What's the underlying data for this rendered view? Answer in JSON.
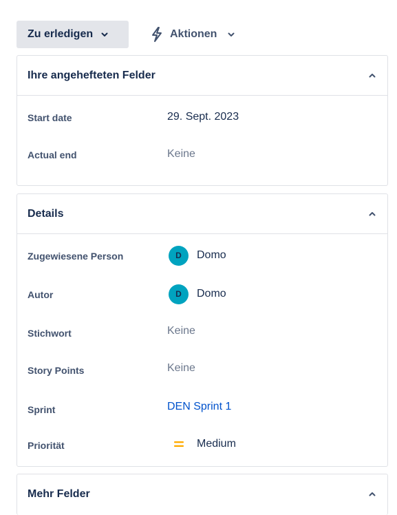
{
  "toolbar": {
    "status_label": "Zu erledigen",
    "actions_label": "Aktionen"
  },
  "pinned": {
    "title": "Ihre angehefteten Felder",
    "fields": [
      {
        "label": "Start date",
        "value": "29. Sept. 2023"
      },
      {
        "label": "Actual end",
        "value": "Keine"
      }
    ]
  },
  "details": {
    "title": "Details",
    "assignee": {
      "label": "Zugewiesene Person",
      "initial": "D",
      "value": "Domo"
    },
    "reporter": {
      "label": "Autor",
      "initial": "D",
      "value": "Domo"
    },
    "labels": {
      "label": "Stichwort",
      "value": "Keine"
    },
    "story_points": {
      "label": "Story Points",
      "value": "Keine"
    },
    "sprint": {
      "label": "Sprint",
      "value": "DEN Sprint 1"
    },
    "priority": {
      "label": "Priorität",
      "value": "Medium",
      "icon": "priority-medium-icon"
    }
  },
  "more": {
    "title": "Mehr Felder"
  },
  "colors": {
    "avatar_bg": "#00a3bf",
    "link": "#0052cc",
    "priority_medium": "#ffab00"
  }
}
